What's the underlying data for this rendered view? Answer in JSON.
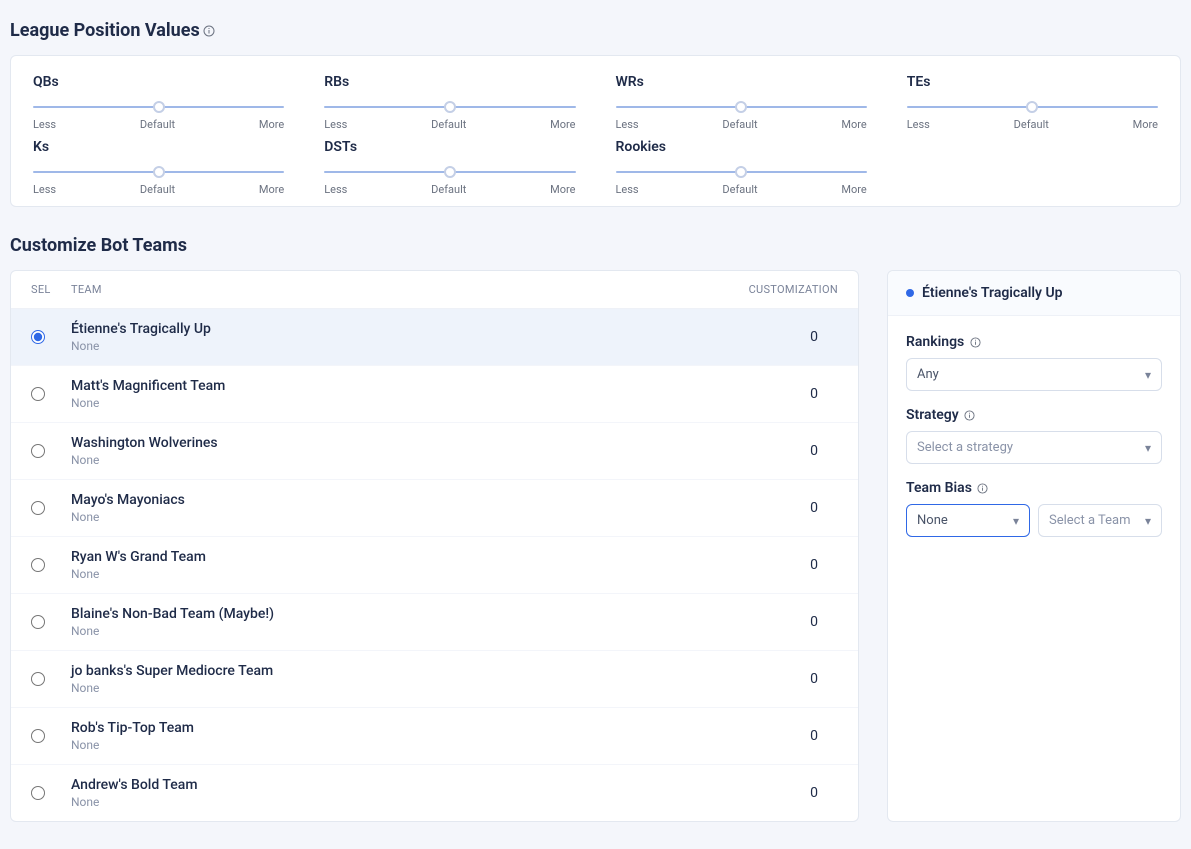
{
  "sections": {
    "position_values_title": "League Position Values",
    "customize_title": "Customize Bot Teams"
  },
  "slider_common": {
    "less": "Less",
    "default": "Default",
    "more": "More"
  },
  "sliders": [
    {
      "label": "QBs",
      "pos": 50
    },
    {
      "label": "RBs",
      "pos": 50
    },
    {
      "label": "WRs",
      "pos": 50
    },
    {
      "label": "TEs",
      "pos": 50
    },
    {
      "label": "Ks",
      "pos": 50
    },
    {
      "label": "DSTs",
      "pos": 50
    },
    {
      "label": "Rookies",
      "pos": 50
    }
  ],
  "table": {
    "header": {
      "sel": "SEL",
      "team": "TEAM",
      "cust": "CUSTOMIZATION"
    },
    "rows": [
      {
        "name": "Étienne's Tragically Up",
        "sub": "None",
        "cust": "0",
        "selected": true
      },
      {
        "name": "Matt's Magnificent Team",
        "sub": "None",
        "cust": "0",
        "selected": false
      },
      {
        "name": "Washington Wolverines",
        "sub": "None",
        "cust": "0",
        "selected": false
      },
      {
        "name": "Mayo's Mayoniacs",
        "sub": "None",
        "cust": "0",
        "selected": false
      },
      {
        "name": "Ryan W's Grand Team",
        "sub": "None",
        "cust": "0",
        "selected": false
      },
      {
        "name": "Blaine's Non-Bad Team (Maybe!)",
        "sub": "None",
        "cust": "0",
        "selected": false
      },
      {
        "name": "jo banks's Super Mediocre Team",
        "sub": "None",
        "cust": "0",
        "selected": false
      },
      {
        "name": "Rob's Tip-Top Team",
        "sub": "None",
        "cust": "0",
        "selected": false
      },
      {
        "name": "Andrew's Bold Team",
        "sub": "None",
        "cust": "0",
        "selected": false
      }
    ]
  },
  "panel": {
    "title": "Étienne's Tragically Up",
    "rankings_label": "Rankings",
    "rankings_value": "Any",
    "strategy_label": "Strategy",
    "strategy_placeholder": "Select a strategy",
    "bias_label": "Team Bias",
    "bias_value": "None",
    "bias_team_placeholder": "Select a Team"
  }
}
